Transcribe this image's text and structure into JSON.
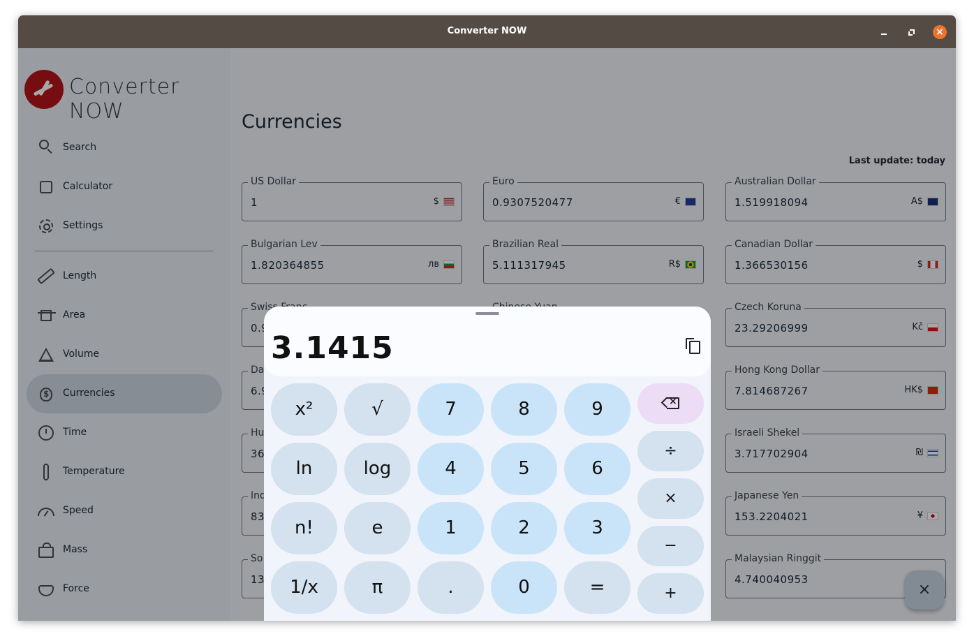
{
  "window": {
    "title": "Converter NOW"
  },
  "sidebar": {
    "brand": "Converter NOW",
    "items": [
      {
        "label": "Search",
        "icon": "search-icon"
      },
      {
        "label": "Calculator",
        "icon": "calculator-icon"
      },
      {
        "label": "Settings",
        "icon": "gear-icon"
      },
      {
        "label": "Length",
        "icon": "ruler-icon"
      },
      {
        "label": "Area",
        "icon": "area-icon"
      },
      {
        "label": "Volume",
        "icon": "flask-icon"
      },
      {
        "label": "Currencies",
        "icon": "money-bag-icon",
        "active": true
      },
      {
        "label": "Time",
        "icon": "clock-icon"
      },
      {
        "label": "Temperature",
        "icon": "thermometer-icon"
      },
      {
        "label": "Speed",
        "icon": "speedometer-icon"
      },
      {
        "label": "Mass",
        "icon": "weight-icon"
      },
      {
        "label": "Force",
        "icon": "force-icon"
      }
    ]
  },
  "main": {
    "title": "Currencies",
    "last_update": "Last update: today",
    "currencies": [
      {
        "name": "US Dollar",
        "value": "1",
        "symbol": "$"
      },
      {
        "name": "Euro",
        "value": "0.9307520477",
        "symbol": "€"
      },
      {
        "name": "Australian Dollar",
        "value": "1.519918094",
        "symbol": "A$"
      },
      {
        "name": "Bulgarian Lev",
        "value": "1.820364855",
        "symbol": "лв"
      },
      {
        "name": "Brazilian Real",
        "value": "5.111317945",
        "symbol": "R$"
      },
      {
        "name": "Canadian Dollar",
        "value": "1.366530156",
        "symbol": "$"
      },
      {
        "name": "Swiss Franc",
        "value": "0.9",
        "symbol": ""
      },
      {
        "name": "Chinese Yuan",
        "value": "",
        "symbol": ""
      },
      {
        "name": "Czech Koruna",
        "value": "23.29206999",
        "symbol": "Kč"
      },
      {
        "name": "Da",
        "value": "6.9",
        "symbol": ""
      },
      {
        "name": "Hong Kong Dollar",
        "value": "7.814687267",
        "symbol": "HK$"
      },
      {
        "name": "Hu",
        "value": "36",
        "symbol": ""
      },
      {
        "name": "Israeli Shekel",
        "value": "3.717702904",
        "symbol": "₪"
      },
      {
        "name": "Ind",
        "value": "83",
        "symbol": ""
      },
      {
        "name": "Japanese Yen",
        "value": "153.2204021",
        "symbol": "¥"
      },
      {
        "name": "So",
        "value": "13",
        "symbol": ""
      },
      {
        "name": "Malaysian Ringgit",
        "value": "4.740040953",
        "symbol": ""
      }
    ]
  },
  "fab": {
    "icon": "close-icon",
    "label": "×"
  },
  "calculator": {
    "display": "3.1415",
    "keys": {
      "square": "x²",
      "sqrt": "√",
      "seven": "7",
      "eight": "8",
      "nine": "9",
      "ln": "ln",
      "log": "log",
      "four": "4",
      "five": "5",
      "six": "6",
      "factorial": "n!",
      "e": "e",
      "one": "1",
      "two": "2",
      "three": "3",
      "reciprocal": "1/x",
      "pi": "π",
      "dot": ".",
      "zero": "0",
      "equals": "=",
      "divide": "÷",
      "multiply": "×",
      "minus": "−",
      "plus": "+"
    }
  }
}
